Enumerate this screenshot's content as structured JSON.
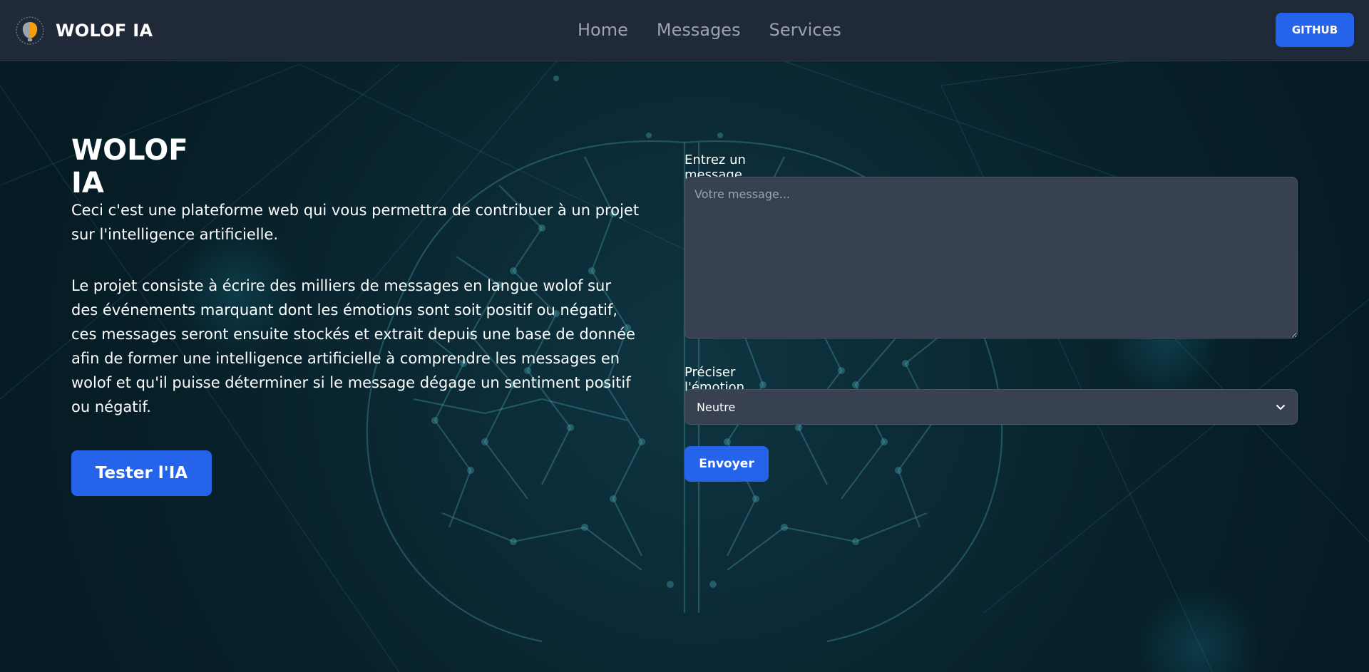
{
  "navbar": {
    "brand_name": "WOLOF IA",
    "links": [
      "Home",
      "Messages",
      "Services"
    ],
    "github_label": "GITHUB"
  },
  "hero": {
    "title": "WOLOF IA",
    "paragraph1": "Ceci c'est une plateforme web qui vous permettra de contribuer à un projet sur l'intelligence artificielle.",
    "paragraph2": "Le projet consiste à écrire des milliers de messages en langue wolof sur des événements marquant dont les émotions sont soit positif ou négatif, ces messages seront ensuite stockés et extrait depuis une base de donnée afin de former une intelligence artificielle à comprendre les messages en wolof et qu'il puisse déterminer si le message dégage un sentiment positif ou négatif.",
    "cta_label": "Tester l'IA"
  },
  "form": {
    "message_label": "Entrez un message sur un événement:",
    "message_placeholder": "Votre message...",
    "emotion_label": "Préciser l'émotion ressentie",
    "emotion_selected": "Neutre",
    "submit_label": "Envoyer"
  },
  "colors": {
    "navbar_bg": "#1f2937",
    "primary": "#2563eb",
    "input_bg": "#374151",
    "nav_link": "#9ca3af"
  }
}
